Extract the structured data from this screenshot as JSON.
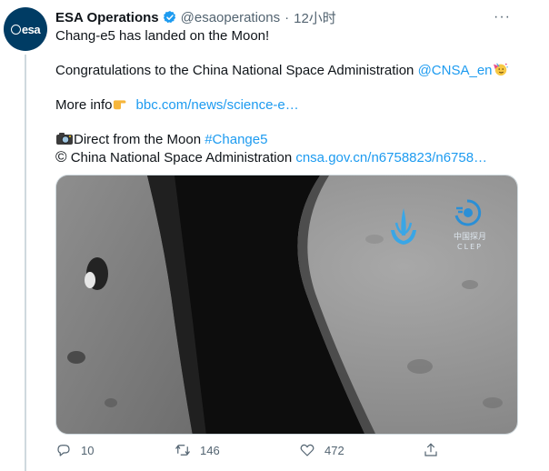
{
  "author": {
    "name": "ESA Operations",
    "handle": "@esaoperations",
    "separator": "·",
    "time": "12小时",
    "avatar_text": "esa"
  },
  "tweet": {
    "line1": "Chang-e5 has landed on the Moon!",
    "line2_text": "Congratulations to the China National Space Administration ",
    "line2_mention": "@CNSA_en",
    "line3_text": "More info",
    "line3_link": "bbc.com/news/science-e…",
    "line4_text": "Direct from the Moon ",
    "line4_hashtag": "#Change5",
    "line5_symbol": "©",
    "line5_text": " China National Space Administration ",
    "line5_link": "cnsa.gov.cn/n6758823/n6758…"
  },
  "media": {
    "watermark_text_cn": "中国探月",
    "watermark_text_en": "CLEP"
  },
  "actions": {
    "reply_count": "10",
    "retweet_count": "146",
    "like_count": "472"
  },
  "colors": {
    "link": "#1d9bf0",
    "verified": "#1d9bf0",
    "secondary": "#536471",
    "esa_navy": "#003c64"
  }
}
